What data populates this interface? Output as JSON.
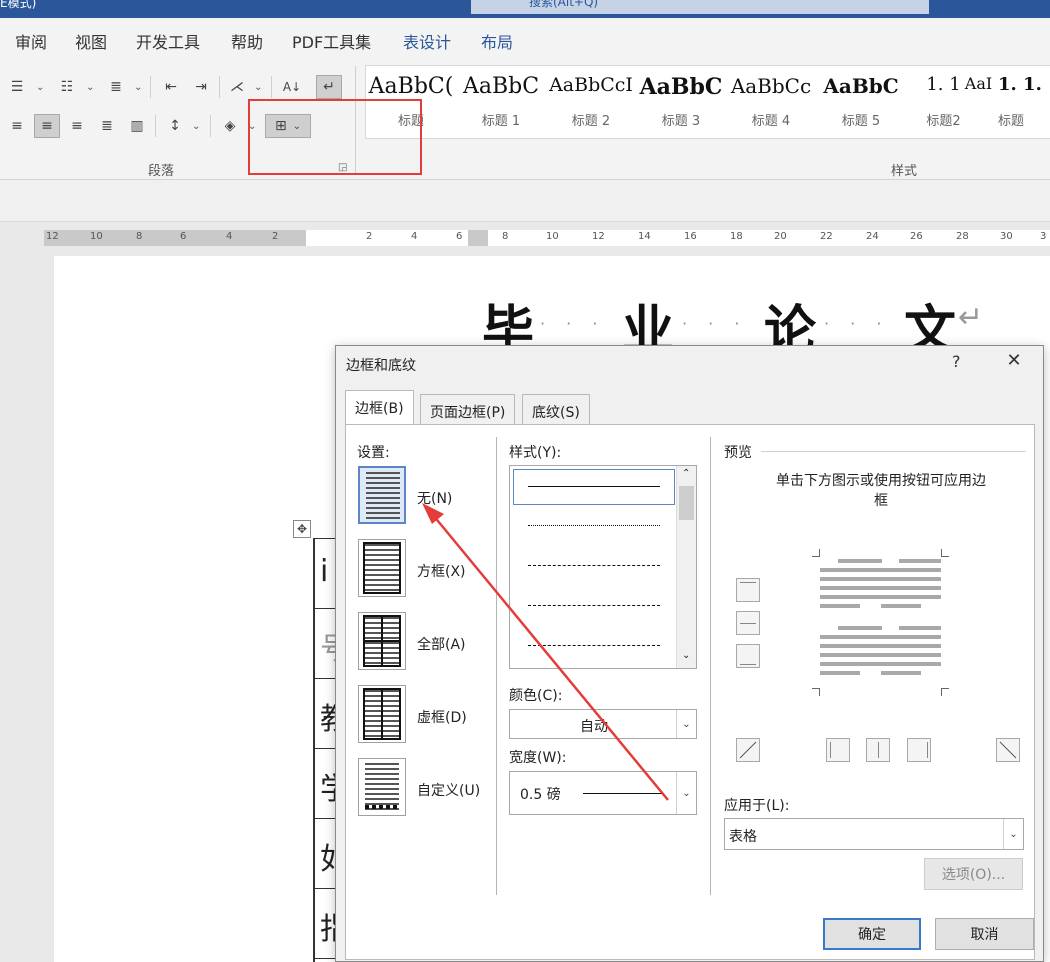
{
  "titlebar": {
    "text": "E模式)",
    "search": "搜索(Alt+Q)"
  },
  "ribbon_tabs": [
    {
      "label": "审阅"
    },
    {
      "label": "视图"
    },
    {
      "label": "开发工具"
    },
    {
      "label": "帮助"
    },
    {
      "label": "PDF工具集"
    },
    {
      "label": "表设计"
    },
    {
      "label": "布局"
    }
  ],
  "ribbon": {
    "paragraph_label": "段落",
    "styles_label": "样式",
    "styles": [
      {
        "preview": "AaBbC(",
        "name": "标题"
      },
      {
        "preview": "AaBbC",
        "name": "标题 1"
      },
      {
        "preview": "AaBbCcI",
        "name": "标题 2"
      },
      {
        "preview": "AaBbC",
        "name": "标题 3"
      },
      {
        "preview": "AaBbCc",
        "name": "标题 4"
      },
      {
        "preview": "AaBbC",
        "name": "标题 5"
      },
      {
        "preview": "1. 1",
        "name": "标题2"
      },
      {
        "preview": "AaI",
        "name": ""
      },
      {
        "preview": "1. 1.",
        "name": "标题"
      }
    ]
  },
  "ruler": {
    "left": [
      "12",
      "10",
      "8",
      "6",
      "4",
      "2"
    ],
    "right": [
      "2",
      "4",
      "6",
      "8",
      "10",
      "12",
      "14",
      "16",
      "18",
      "20",
      "22",
      "24",
      "26",
      "28",
      "30",
      "3"
    ]
  },
  "document": {
    "title_chars": [
      "毕",
      "业",
      "论",
      "文"
    ],
    "dots": "· · ·",
    "cell_chars": [
      "i",
      "号",
      "教",
      "学",
      "如",
      "指"
    ]
  },
  "dialog": {
    "title": "边框和底纹",
    "help": "?",
    "close": "✕",
    "tabs": [
      {
        "label": "边框(B)"
      },
      {
        "label": "页面边框(P)"
      },
      {
        "label": "底纹(S)"
      }
    ],
    "setting_label": "设置:",
    "settings": [
      {
        "label": "无(N)"
      },
      {
        "label": "方框(X)"
      },
      {
        "label": "全部(A)"
      },
      {
        "label": "虚框(D)"
      },
      {
        "label": "自定义(U)"
      }
    ],
    "style_label": "样式(Y):",
    "color_label": "颜色(C):",
    "color_value": "自动",
    "width_label": "宽度(W):",
    "width_value": "0.5 磅",
    "preview_label": "预览",
    "preview_hint": "单击下方图示或使用按钮可应用边框",
    "apply_label": "应用于(L):",
    "apply_value": "表格",
    "options_button": "选项(O)...",
    "ok_button": "确定",
    "cancel_button": "取消"
  },
  "colors": {
    "accent": "#2b579a",
    "annotation": "#e43b3b"
  }
}
